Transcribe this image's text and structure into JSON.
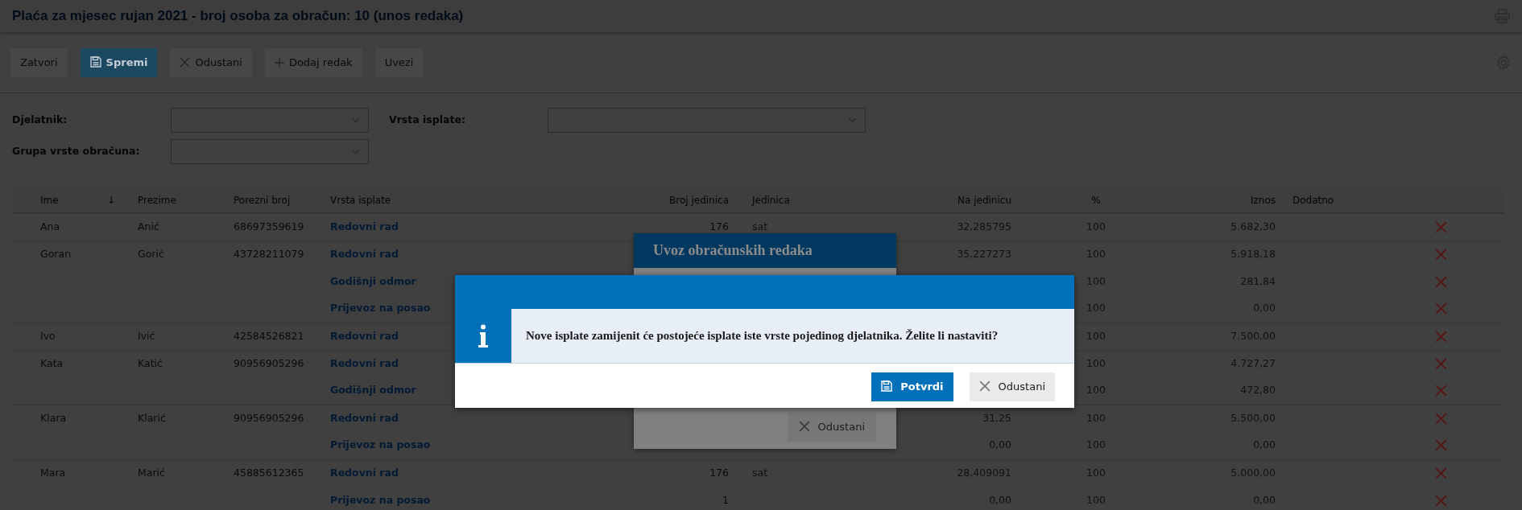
{
  "title": "Plaća za mjesec rujan 2021 - broj osoba za obračun: 10 (unos redaka)",
  "toolbar": [
    {
      "label": "Zatvori",
      "kind": "plain"
    },
    {
      "label": "Spremi",
      "kind": "primary"
    },
    {
      "label": "Odustani",
      "kind": "cancel"
    },
    {
      "label": "Dodaj redak",
      "kind": "add"
    },
    {
      "label": "Uvezi",
      "kind": "plain"
    }
  ],
  "filters": [
    {
      "label": "Djelatnik:"
    },
    {
      "label": "Vrsta isplate:"
    },
    {
      "label": "Grupa vrste obračuna:"
    }
  ],
  "table": {
    "columns": [
      "Ime",
      "Prezime",
      "Porezni broj",
      "Vrsta isplate",
      "Broj jedinica",
      "Jedinica",
      "Na jedinicu",
      "%",
      "Iznos",
      "Dodatno"
    ],
    "sort_indicator": "↓",
    "groups": [
      {
        "ime": "Ana",
        "prezime": "Anić",
        "porezni_broj": "68697359619",
        "lines": [
          {
            "vrsta_isplate": "Redovni rad",
            "broj_jedinica": "176",
            "jedinica": "sat",
            "na_jedinicu": "32,285795",
            "postotak": "100",
            "iznos": "5.682,30"
          }
        ]
      },
      {
        "ime": "Goran",
        "prezime": "Gorić",
        "porezni_broj": "43728211079",
        "lines": [
          {
            "vrsta_isplate": "Redovni rad",
            "na_jedinicu": "35,227273",
            "postotak": "100",
            "iznos": "5.918,18"
          },
          {
            "vrsta_isplate": "Godišnji odmor",
            "postotak": "100",
            "iznos": "281,84"
          },
          {
            "vrsta_isplate": "Prijevoz na posao",
            "postotak": "100",
            "iznos": "0,00"
          }
        ]
      },
      {
        "ime": "Ivo",
        "prezime": "Ivić",
        "porezni_broj": "42584526821",
        "lines": [
          {
            "vrsta_isplate": "Redovni rad",
            "postotak": "100",
            "iznos": "7.500,00"
          }
        ]
      },
      {
        "ime": "Kata",
        "prezime": "Katić",
        "porezni_broj": "90956905296",
        "lines": [
          {
            "vrsta_isplate": "Redovni rad",
            "postotak": "100",
            "iznos": "4.727,27"
          },
          {
            "vrsta_isplate": "Godišnji odmor",
            "postotak": "100",
            "iznos": "472,80"
          }
        ]
      },
      {
        "ime": "Klara",
        "prezime": "Klarić",
        "porezni_broj": "90956905296",
        "lines": [
          {
            "vrsta_isplate": "Redovni rad",
            "na_jedinicu": "31,25",
            "postotak": "100",
            "iznos": "5.500,00"
          },
          {
            "vrsta_isplate": "Prijevoz na posao",
            "na_jedinicu": "0,00",
            "postotak": "100",
            "iznos": "0,00"
          }
        ]
      },
      {
        "ime": "Mara",
        "prezime": "Marić",
        "porezni_broj": "45885612365",
        "lines": [
          {
            "vrsta_isplate": "Redovni rad",
            "broj_jedinica": "176",
            "jedinica": "sat",
            "na_jedinicu": "28,409091",
            "postotak": "100",
            "iznos": "5.000,00"
          },
          {
            "vrsta_isplate": "Prijevoz na posao",
            "broj_jedinica": "1",
            "na_jedinicu": "0,00",
            "postotak": "100",
            "iznos": "0,00"
          }
        ]
      }
    ]
  },
  "background_dialog": {
    "title": "Uvoz obračunskih redaka",
    "buttons": [
      {
        "label": "Odustani",
        "kind": "cancel"
      }
    ]
  },
  "dialog": {
    "message": "Nove isplate zamijenit će postojeće isplate iste vrste pojedinog djelatnika. Želite li nastaviti?",
    "buttons": [
      {
        "label": "Potvrdi",
        "kind": "confirm"
      },
      {
        "label": "Odustani",
        "kind": "cancel"
      }
    ]
  }
}
